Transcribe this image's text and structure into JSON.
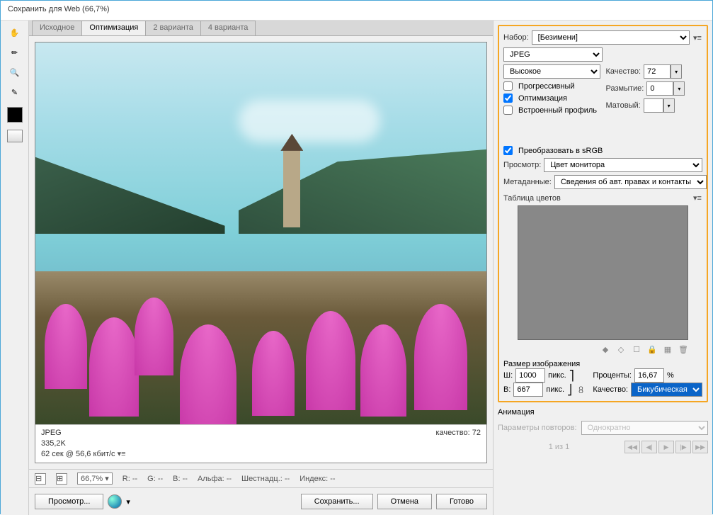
{
  "title": "Сохранить для Web (66,7%)",
  "tabs": [
    "Исходное",
    "Оптимизация",
    "2 варианта",
    "4 варианта"
  ],
  "preview_info": {
    "format": "JPEG",
    "size": "335,2K",
    "time": "62 сек @ 56,6 кбит/с",
    "quality_readout": "качество: 72"
  },
  "status": {
    "zoom": "66,7%",
    "r": "R: --",
    "g": "G: --",
    "b": "B: --",
    "alpha": "Альфа: --",
    "hex": "Шестнадц.: --",
    "index": "Индекс: --"
  },
  "footer": {
    "preview": "Просмотр...",
    "save": "Сохранить...",
    "cancel": "Отмена",
    "done": "Готово"
  },
  "settings": {
    "preset_label": "Набор:",
    "preset_value": "[Безимени]",
    "format": "JPEG",
    "quality_preset": "Высокое",
    "quality_label": "Качество:",
    "quality_value": "72",
    "blur_label": "Размытие:",
    "blur_value": "0",
    "matte_label": "Матовый:",
    "progressive": "Прогрессивный",
    "optimized": "Оптимизация",
    "embed_profile": "Встроенный профиль",
    "to_srgb": "Преобразовать в sRGB",
    "preview_label": "Просмотр:",
    "preview_value": "Цвет монитора",
    "metadata_label": "Метаданные:",
    "metadata_value": "Сведения об авт. правах и контакты"
  },
  "color_table": {
    "title": "Таблица цветов"
  },
  "image_size": {
    "title": "Размер изображения",
    "w_label": "Ш:",
    "w_value": "1000",
    "h_label": "В:",
    "h_value": "667",
    "px": "пикс.",
    "percent_label": "Проценты:",
    "percent_value": "16,67",
    "percent_suffix": "%",
    "quality_label": "Качество:",
    "quality_value": "Бикубическая"
  },
  "animation": {
    "title": "Анимация",
    "loop_label": "Параметры повторов:",
    "loop_value": "Однократно",
    "frame": "1 из 1"
  }
}
